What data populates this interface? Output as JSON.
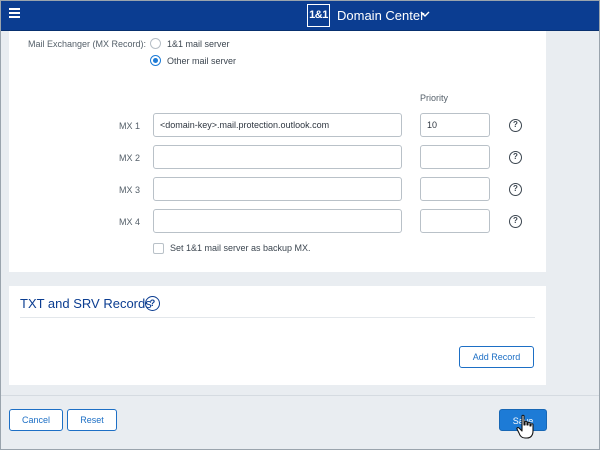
{
  "header": {
    "logo_text": "1&1",
    "app_title": "Domain Center"
  },
  "mx_section": {
    "label": "Mail Exchanger (MX Record):",
    "options": [
      {
        "label": "1&1 mail server",
        "selected": false
      },
      {
        "label": "Other mail server",
        "selected": true
      }
    ],
    "priority_header": "Priority",
    "rows": [
      {
        "label": "MX 1",
        "value": "<domain-key>.mail.protection.outlook.com",
        "priority": "10"
      },
      {
        "label": "MX 2",
        "value": "",
        "priority": ""
      },
      {
        "label": "MX 3",
        "value": "",
        "priority": ""
      },
      {
        "label": "MX 4",
        "value": "",
        "priority": ""
      }
    ],
    "help_glyph": "?",
    "backup_checkbox_label": "Set 1&1 mail server as backup MX.",
    "backup_checked": false
  },
  "txt_srv_section": {
    "title": "TXT and SRV Records",
    "help_glyph": "?",
    "add_record_label": "Add Record"
  },
  "footer": {
    "cancel_label": "Cancel",
    "reset_label": "Reset",
    "save_label": "Save"
  },
  "colors": {
    "topbar": "#0b3d91",
    "accent": "#1d7bd6",
    "background": "#e9edf1"
  }
}
